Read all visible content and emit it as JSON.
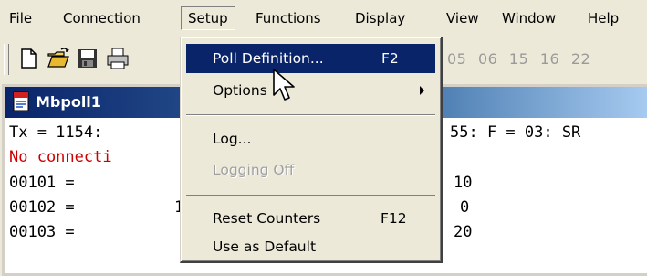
{
  "menubar": {
    "items": [
      "File",
      "Connection",
      "Setup",
      "Functions",
      "Display",
      "View",
      "Window",
      "Help"
    ],
    "open_menu": "Setup"
  },
  "toolbar": {
    "icons": [
      "new-document-icon",
      "open-folder-icon",
      "save-disk-icon",
      "print-icon"
    ],
    "function_codes": [
      "05",
      "06",
      "15",
      "16",
      "22"
    ]
  },
  "window": {
    "title": "Mbpoll1",
    "icon": "app-document-icon",
    "status_line_left": "Tx = 1154:",
    "status_line_right": "55: F = 03: SR",
    "error_text": "No connecti",
    "rows": [
      {
        "address": "00101 =",
        "partial": "",
        "value": "10"
      },
      {
        "address": "00102 =",
        "partial": "1",
        "value": "0"
      },
      {
        "address": "00103 =",
        "partial": "",
        "value": "20"
      }
    ]
  },
  "setup_menu": {
    "poll_definition": {
      "label": "Poll Definition...",
      "shortcut": "F2"
    },
    "options": {
      "label": "Options"
    },
    "log": {
      "label": "Log..."
    },
    "logging_off": {
      "label": "Logging Off",
      "disabled": true
    },
    "reset_counters": {
      "label": "Reset Counters",
      "shortcut": "F12"
    },
    "use_as_default": {
      "label": "Use as Default"
    }
  },
  "colors": {
    "highlight": "#0a246a",
    "title_gradient_start": "#0a246a",
    "title_gradient_end": "#a6caf0",
    "error_text": "#cc0000",
    "disabled_text": "#a0a0a0"
  }
}
